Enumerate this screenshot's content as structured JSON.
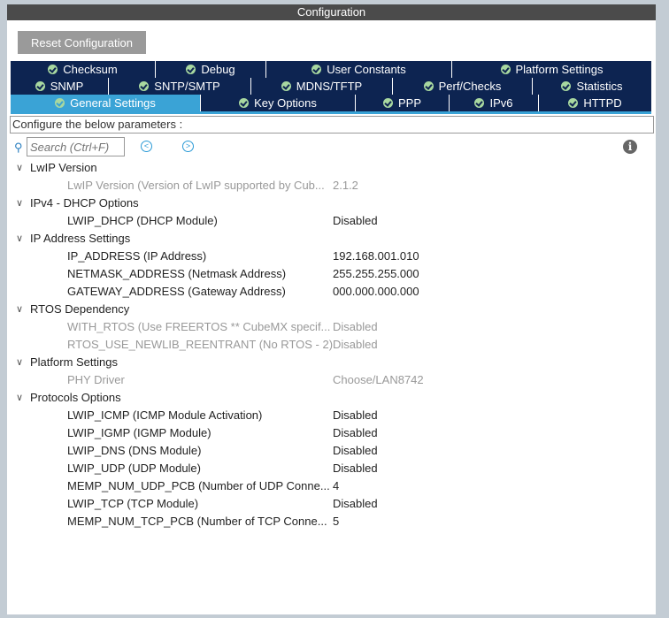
{
  "title": "Configuration",
  "reset_label": "Reset Configuration",
  "tabs_row1": [
    "Checksum",
    "Debug",
    "User Constants",
    "Platform Settings"
  ],
  "tabs_row2": [
    "SNMP",
    "SNTP/SMTP",
    "MDNS/TFTP",
    "Perf/Checks",
    "Statistics"
  ],
  "tabs_row3": [
    "General Settings",
    "Key Options",
    "PPP",
    "IPv6",
    "HTTPD"
  ],
  "hint": "Configure the below parameters :",
  "search_placeholder": "Search (Ctrl+F)",
  "groups": [
    {
      "name": "LwIP Version",
      "params": [
        {
          "name": "LwIP Version (Version of LwIP supported by Cub...",
          "value": "2.1.2",
          "disabled": true
        }
      ]
    },
    {
      "name": "IPv4 - DHCP Options",
      "params": [
        {
          "name": "LWIP_DHCP (DHCP Module)",
          "value": "Disabled",
          "disabled": false
        }
      ]
    },
    {
      "name": "IP Address Settings",
      "params": [
        {
          "name": "IP_ADDRESS (IP Address)",
          "value": "192.168.001.010",
          "disabled": false
        },
        {
          "name": "NETMASK_ADDRESS (Netmask Address)",
          "value": "255.255.255.000",
          "disabled": false
        },
        {
          "name": "GATEWAY_ADDRESS (Gateway Address)",
          "value": "000.000.000.000",
          "disabled": false
        }
      ]
    },
    {
      "name": "RTOS Dependency",
      "params": [
        {
          "name": "WITH_RTOS (Use FREERTOS ** CubeMX specif...",
          "value": "Disabled",
          "disabled": true
        },
        {
          "name": "RTOS_USE_NEWLIB_REENTRANT (No RTOS - 2)",
          "value": "Disabled",
          "disabled": true
        }
      ]
    },
    {
      "name": "Platform Settings",
      "params": [
        {
          "name": "PHY Driver",
          "value": "Choose/LAN8742",
          "disabled": true
        }
      ]
    },
    {
      "name": "Protocols Options",
      "params": [
        {
          "name": "LWIP_ICMP (ICMP Module Activation)",
          "value": "Disabled",
          "disabled": false
        },
        {
          "name": "LWIP_IGMP (IGMP Module)",
          "value": "Disabled",
          "disabled": false
        },
        {
          "name": "LWIP_DNS (DNS Module)",
          "value": "Disabled",
          "disabled": false
        },
        {
          "name": "LWIP_UDP (UDP Module)",
          "value": "Disabled",
          "disabled": false
        },
        {
          "name": "MEMP_NUM_UDP_PCB (Number of UDP Conne...",
          "value": "4",
          "disabled": false
        },
        {
          "name": "LWIP_TCP (TCP Module)",
          "value": "Disabled",
          "disabled": false
        },
        {
          "name": "MEMP_NUM_TCP_PCB (Number of TCP Conne...",
          "value": "5",
          "disabled": false
        }
      ]
    }
  ]
}
